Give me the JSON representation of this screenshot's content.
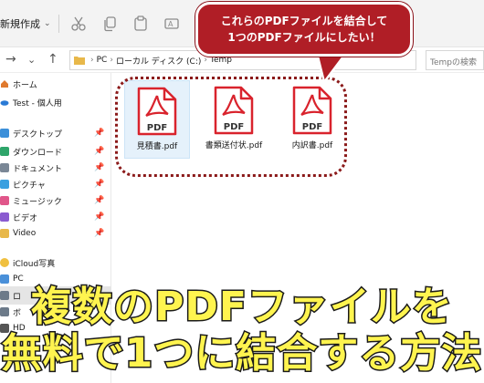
{
  "toolbar": {
    "new_label": "新規作成",
    "icons": [
      "cut-icon",
      "copy-icon",
      "paste-icon",
      "rename-icon"
    ]
  },
  "address": {
    "crumbs": [
      "PC",
      "ローカル ディスク (C:)",
      "Temp"
    ],
    "search_placeholder": "Tempの検索"
  },
  "sidebar": {
    "items": [
      {
        "label": "ホーム",
        "pinned": false
      },
      {
        "label": "Test - 個人用",
        "pinned": false
      },
      {
        "label": "デスクトップ",
        "pinned": true
      },
      {
        "label": "ダウンロード",
        "pinned": true
      },
      {
        "label": "ドキュメント",
        "pinned": true
      },
      {
        "label": "ピクチャ",
        "pinned": true
      },
      {
        "label": "ミュージック",
        "pinned": true
      },
      {
        "label": "ビデオ",
        "pinned": true
      },
      {
        "label": "Video",
        "pinned": true
      },
      {
        "label": "iCloud写真",
        "pinned": false
      },
      {
        "label": "PC",
        "pinned": false
      },
      {
        "label": "ロ",
        "pinned": false
      },
      {
        "label": "ボ",
        "pinned": false
      },
      {
        "label": "HD",
        "pinned": false
      }
    ]
  },
  "files": [
    {
      "name": "見積書.pdf",
      "icon_text": "PDF",
      "selected": true
    },
    {
      "name": "書類送付状.pdf",
      "icon_text": "PDF",
      "selected": false
    },
    {
      "name": "内訳書.pdf",
      "icon_text": "PDF",
      "selected": false
    }
  ],
  "callout": {
    "line1": "これらのPDFファイルを結合して",
    "line2": "1つのPDFファイルにしたい！"
  },
  "banner": {
    "line1": "複数のPDFファイルを",
    "line2": "無料で1つに結合する方法"
  },
  "colors": {
    "accent_red": "#b01e26",
    "pdf_red": "#d9232d",
    "banner_yellow": "#fff44f",
    "dotted_border": "#8b1a1a"
  }
}
